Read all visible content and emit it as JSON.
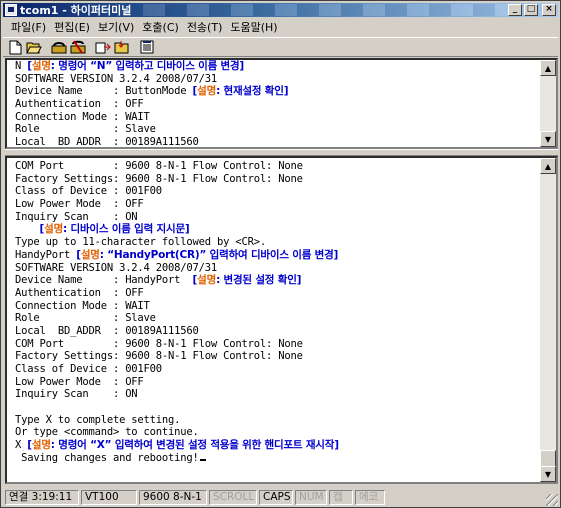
{
  "window": {
    "title": "tcom1 - 하이퍼터미널"
  },
  "menu": [
    {
      "label": "파일(F)"
    },
    {
      "label": "편집(E)"
    },
    {
      "label": "보기(V)"
    },
    {
      "label": "호출(C)"
    },
    {
      "label": "전송(T)"
    },
    {
      "label": "도움말(H)"
    }
  ],
  "toolbar": {
    "icons": [
      "new-icon",
      "open-icon",
      "call-icon",
      "disconnect-icon",
      "send-icon",
      "receive-icon",
      "properties-icon"
    ]
  },
  "top_pane": {
    "lines": [
      {
        "text": "N ",
        "note_tag": "설명",
        "note": ": 명령어 “N” 입력하고 디바이스 이름 변경]"
      },
      {
        "text": "SOFTWARE VERSION 3.2.4 2008/07/31"
      },
      {
        "text": "Device Name     : ButtonMode ",
        "note_tag": "설명",
        "note": ": 현재설정 확인]"
      },
      {
        "text": "Authentication  : OFF"
      },
      {
        "text": "Connection Mode : WAIT"
      },
      {
        "text": "Role            : Slave"
      },
      {
        "text": "Local  BD_ADDR  : 00189A111560"
      }
    ]
  },
  "bottom_pane": {
    "lines": [
      {
        "text": "COM Port        : 9600 8-N-1 Flow Control: None"
      },
      {
        "text": "Factory Settings: 9600 8-N-1 Flow Control: None"
      },
      {
        "text": "Class of Device : 001F00"
      },
      {
        "text": "Low Power Mode  : OFF"
      },
      {
        "text": "Inquiry Scan    : ON"
      },
      {
        "text": "    ",
        "note_tag": "설명",
        "note": ": 디바이스 이름 입력 지시문]"
      },
      {
        "text": "Type up to 11-character followed by <CR>."
      },
      {
        "text": "HandyPort ",
        "note_tag": "설명",
        "note": ": “HandyPort(CR)” 입력하여 디바이스 이름 변경]"
      },
      {
        "text": "SOFTWARE VERSION 3.2.4 2008/07/31"
      },
      {
        "text": "Device Name     : HandyPort  ",
        "note_tag": "설명",
        "note": ": 변경된 설정 확인]"
      },
      {
        "text": "Authentication  : OFF"
      },
      {
        "text": "Connection Mode : WAIT"
      },
      {
        "text": "Role            : Slave"
      },
      {
        "text": "Local  BD_ADDR  : 00189A111560"
      },
      {
        "text": "COM Port        : 9600 8-N-1 Flow Control: None"
      },
      {
        "text": "Factory Settings: 9600 8-N-1 Flow Control: None"
      },
      {
        "text": "Class of Device : 001F00"
      },
      {
        "text": "Low Power Mode  : OFF"
      },
      {
        "text": "Inquiry Scan    : ON"
      },
      {
        "text": ""
      },
      {
        "text": "Type X to complete setting."
      },
      {
        "text": "Or type <command> to continue."
      },
      {
        "text": "X ",
        "note_tag": "설명",
        "note": ": 명령어 “X” 입력하여 변경된 설정 적용을 위한 핸디포트 재시작]"
      },
      {
        "text": " Saving changes and rebooting!",
        "cursor": true
      }
    ]
  },
  "status": {
    "connected": "연결 3:19:11",
    "emulation": "VT100",
    "port_settings": "9600 8-N-1",
    "scroll": "SCROLL",
    "caps": "CAPS",
    "num": "NUM",
    "capture": "캡",
    "echo": "에코"
  },
  "colors": {
    "note_text": "#0000cc",
    "note_tag": "#e06000",
    "title_bar": "#0a246a"
  }
}
